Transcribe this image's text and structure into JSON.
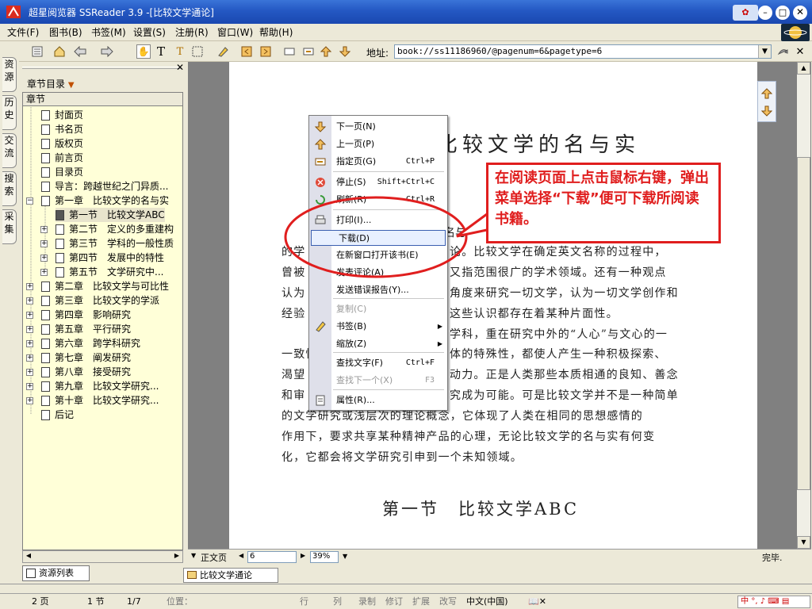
{
  "app": {
    "title": "超星阅览器 SSReader 3.9 -[比较文学通论]"
  },
  "menus": [
    "文件(F)",
    "图书(B)",
    "书签(M)",
    "设置(S)",
    "注册(R)",
    "窗口(W)",
    "帮助(H)"
  ],
  "toolbar": {
    "address_label": "地址:",
    "address_value": "book://ss11186960/@pagenum=6&pagetype=6"
  },
  "side_tabs": [
    "资源",
    "历史",
    "交流",
    "搜索",
    "采集"
  ],
  "toc": {
    "header": "章节目录",
    "column": "章节",
    "items": [
      "封面页",
      "书名页",
      "版权页",
      "前言页",
      "目录页",
      "导言：跨越世纪之门异质...",
      "第一章　比较文学的名与实",
      "第一节　比较文学ABC",
      "第二节　定义的多重建构",
      "第三节　学科的一般性质",
      "第四节　发展中的特性",
      "第五节　文学研究中...",
      "第二章　比较文学与可比性",
      "第三章　比较文学的学派",
      "第四章　影响研究",
      "第五章　平行研究",
      "第六章　跨学科研究",
      "第七章　阐发研究",
      "第八章　接受研究",
      "第九章　比较文学研究...",
      "第十章　比较文学研究...",
      "后记"
    ]
  },
  "side_bottom_tab": "资源列表",
  "doc_tab": "比较文学通论",
  "page": {
    "heading": "比较文学的名与实",
    "para_partial_top": "名与",
    "lines": [
      "的学",
      "曾被",
      "认为",
      "经验",
      "一致性",
      "渴望",
      "和审"
    ],
    "lines_right": [
      "论。比较文学在确定英文名称的过程中，",
      "又指范围很广的学术领域。还有一种观点",
      "角度来研究一切文学，认为一切文学创作和",
      "这些认识都存在着某种片面性。",
      "学科，重在研究中外的“人心”与文心的一",
      "体的特殊性，都使人产生一种积极探索、",
      "动力。正是人类那些本质相通的良知、善念",
      "究成为可能。可是比较文学并不是一种简单"
    ],
    "full_lines": [
      "的文学研究或浅层次的理论概念，它体现了人类在相同的思想感情的",
      "作用下，要求共享某种精神产品的心理，无论比较文学的名与实有何变",
      "化，它都会将文学研究引申到一个未知领域。"
    ],
    "section_title": "第一节　比较文学ABC"
  },
  "context_menu": [
    {
      "label": "下一页(N)",
      "shortcut": "",
      "icon": "arrow-down-icon"
    },
    {
      "label": "上一页(P)",
      "shortcut": "",
      "icon": "arrow-up-icon"
    },
    {
      "label": "指定页(G)",
      "shortcut": "Ctrl+P",
      "icon": "goto-page-icon"
    },
    {
      "label": "停止(S)",
      "shortcut": "Shift+Ctrl+C",
      "icon": "stop-icon"
    },
    {
      "label": "刷新(R)",
      "shortcut": "Ctrl+R",
      "icon": "refresh-icon"
    },
    {
      "label": "打印(I)...",
      "shortcut": "",
      "icon": "print-icon"
    },
    {
      "label": "下载(D)",
      "shortcut": "",
      "icon": ""
    },
    {
      "label": "在新窗口打开该书(E)",
      "shortcut": "",
      "icon": ""
    },
    {
      "label": "发表评论(A)",
      "shortcut": "",
      "icon": ""
    },
    {
      "label": "发送错误报告(Y)...",
      "shortcut": "",
      "icon": ""
    },
    {
      "label": "复制(C)",
      "shortcut": "",
      "icon": ""
    },
    {
      "label": "书签(B)",
      "shortcut": "",
      "icon": "bookmark-icon"
    },
    {
      "label": "缩放(Z)",
      "shortcut": "",
      "icon": ""
    },
    {
      "label": "查找文字(F)",
      "shortcut": "Ctrl+F",
      "icon": ""
    },
    {
      "label": "查找下一个(X)",
      "shortcut": "F3",
      "icon": ""
    },
    {
      "label": "属性(R)...",
      "shortcut": "",
      "icon": "properties-icon"
    }
  ],
  "callout": "在阅读页面上点击鼠标右键，弹出菜单选择“下载”便可下载所阅读书籍。",
  "reader_status": {
    "view": "正文页",
    "page_input": "6",
    "zoom": "39%",
    "done": "完毕."
  },
  "statusbar": {
    "page": "2 页",
    "section": "1 节",
    "ratio": "1/7",
    "position": "位置：",
    "row": "行",
    "col": "列",
    "rec": "录制",
    "edit": "修订",
    "ext": "扩展",
    "ovr": "改写",
    "lang": "中文(中国)"
  },
  "colors": {
    "title_blue": "#2458c3",
    "callout_red": "#e01e1e",
    "toc_bg": "#ffffd8"
  }
}
